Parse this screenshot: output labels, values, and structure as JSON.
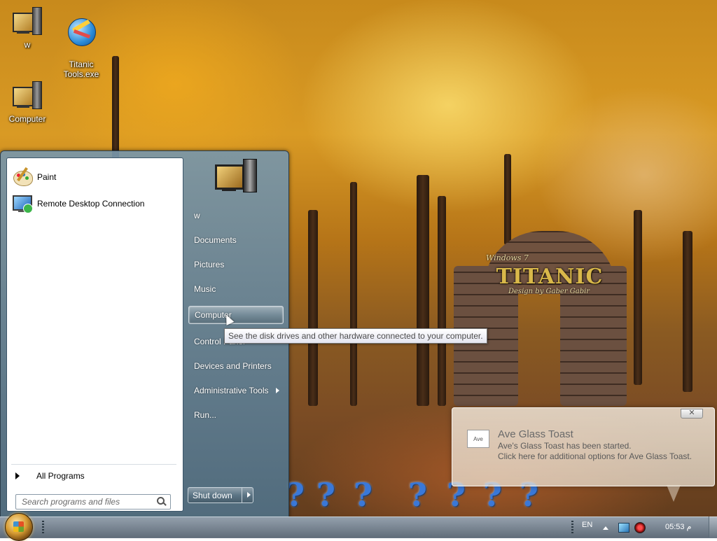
{
  "desktop": {
    "icons": [
      {
        "label": "w",
        "icon": "user-computer-icon"
      },
      {
        "label": "Titanic\nTools.exe",
        "icon": "titanic-tools-icon"
      },
      {
        "label": "Computer",
        "icon": "computer-icon"
      }
    ],
    "wallpaper": {
      "title": "TITANIC",
      "subtitle_top": "Windows 7",
      "subtitle_bottom": "Design by Gaber Gabir"
    }
  },
  "start_menu": {
    "pinned_programs": [
      {
        "label": "Paint",
        "icon": "paint-icon"
      },
      {
        "label": "Remote Desktop Connection",
        "icon": "remote-desktop-icon"
      }
    ],
    "all_programs": "All Programs",
    "search_placeholder": "Search programs and files",
    "right_items": [
      {
        "label": "w"
      },
      {
        "label": "Documents"
      },
      {
        "label": "Pictures"
      },
      {
        "label": "Music"
      },
      {
        "label": "Computer"
      },
      {
        "label": "Control Panel"
      },
      {
        "label": "Devices and Printers"
      },
      {
        "label": "Administrative Tools"
      },
      {
        "label": "Run..."
      }
    ],
    "shutdown_label": "Shut down"
  },
  "tooltip": {
    "text": "See the disk drives and other hardware connected to your computer."
  },
  "toast": {
    "icon_label": "Ave",
    "title": "Ave Glass Toast",
    "line1": "Ave's Glass Toast has been started.",
    "line2": "Click here for additional options for Ave Glass Toast.",
    "close_glyph": "✕"
  },
  "taskbar": {
    "language": "EN",
    "clock": "05:53 م"
  }
}
